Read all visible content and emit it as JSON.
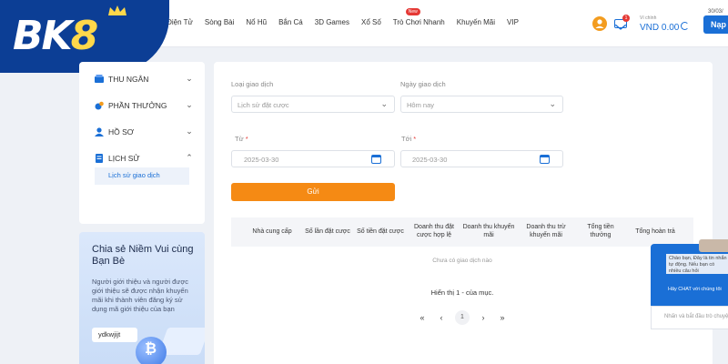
{
  "brand": {
    "logo_prefix": "BK",
    "logo_suffix": "8"
  },
  "nav": {
    "items": [
      {
        "label": "ao Điện Tử"
      },
      {
        "label": "Sòng Bài"
      },
      {
        "label": "Nổ Hũ"
      },
      {
        "label": "Bắn Cá"
      },
      {
        "label": "3D Games"
      },
      {
        "label": "Xổ Số"
      },
      {
        "label": "Trò Chơi Nhanh",
        "badge": "New"
      },
      {
        "label": "Khuyến Mãi"
      },
      {
        "label": "VIP"
      }
    ]
  },
  "header": {
    "mail_count": "1",
    "wallet_label": "Ví chính",
    "balance": "VND 0.00",
    "date": "30/03/",
    "deposit_label": "Nạp t"
  },
  "sidebar": {
    "items": [
      {
        "label": "THU NGÂN",
        "expanded": false
      },
      {
        "label": "PHẦN THƯỞNG",
        "expanded": false
      },
      {
        "label": "HỒ SƠ",
        "expanded": false
      },
      {
        "label": "LỊCH SỬ",
        "expanded": true
      }
    ],
    "subitem": "Lịch sử giao dịch"
  },
  "referral": {
    "title": "Chia sẻ Niềm Vui cùng Bạn Bè",
    "description": "Người giới thiệu và người được giới thiệu sẽ được nhận khuyến mãi khi thành viên đăng ký sử dụng mã giới thiệu của bạn",
    "code": "ydkwjijt"
  },
  "filters": {
    "type_label": "Loại giao dịch",
    "type_value": "Lịch sử đặt cược",
    "date_label": "Ngày giao dịch",
    "date_value": "Hôm nay",
    "from_label": "Từ",
    "from_value": "2025-03-30",
    "to_label": "Tới",
    "to_value": "2025-03-30",
    "required_mark": "*",
    "submit_label": "Gửi"
  },
  "table": {
    "columns": [
      "Nhà cung cấp",
      "Số lần đặt cược",
      "Số tiền đặt cược",
      "Doanh thu đặt cược hợp lệ",
      "Doanh thu khuyến mãi",
      "Doanh thu trừ khuyến mãi",
      "Tổng tiền thưởng",
      "Tổng hoàn trả"
    ],
    "empty_message": "Chưa có giao dịch nào",
    "showing": "Hiển thị 1 - của mục.",
    "current_page": "1"
  },
  "chat": {
    "message": "Chào bạn, Đây là tin nhắn tự động. Nếu bạn có nhiều câu hỏi",
    "cta": "Hãy CHAT với chúng tôi",
    "input_placeholder": "Nhấn và bắt đầu trò chuyện"
  },
  "colors": {
    "primary": "#1a6fd6",
    "brand_blue": "#0c3e95",
    "accent": "#f58a14",
    "logo_gold": "#ffd84a"
  }
}
